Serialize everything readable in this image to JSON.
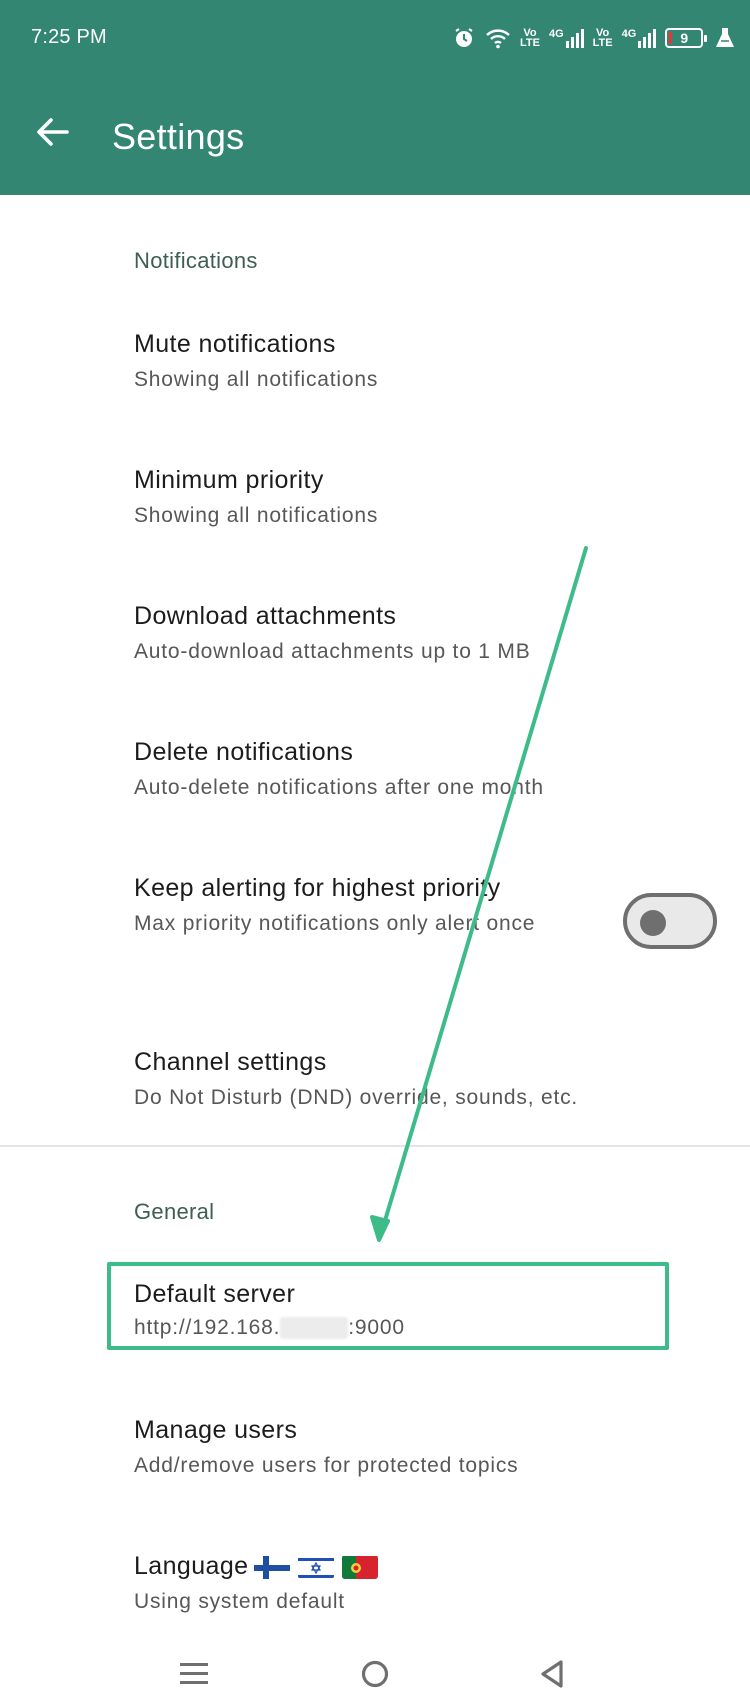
{
  "status_bar": {
    "time": "7:25 PM",
    "volte1": "Vo\nLTE",
    "net1": "4G",
    "volte2": "Vo\nLTE",
    "net2": "4G",
    "battery_level": "9",
    "icons": [
      "alarm-icon",
      "wifi-icon",
      "volte-icon",
      "signal-icon",
      "volte-icon",
      "signal-icon",
      "battery-icon",
      "flask-icon"
    ]
  },
  "app_bar": {
    "title": "Settings",
    "color": "#338772"
  },
  "sections": {
    "notifications": {
      "header": "Notifications",
      "items": [
        {
          "title": "Mute notifications",
          "summary": "Showing all notifications"
        },
        {
          "title": "Minimum priority",
          "summary": "Showing all notifications"
        },
        {
          "title": "Download attachments",
          "summary": "Auto-download attachments up to 1 MB"
        },
        {
          "title": "Delete notifications",
          "summary": "Auto-delete notifications after one month"
        },
        {
          "title": "Keep alerting for highest priority",
          "summary": "Max priority notifications only alert once",
          "toggle_on": false
        },
        {
          "title": "Channel settings",
          "summary": "Do Not Disturb (DND) override, sounds, etc."
        }
      ]
    },
    "general": {
      "header": "General",
      "items": [
        {
          "title": "Default server",
          "summary_prefix": "http://192.168.",
          "summary_suffix": ":9000"
        },
        {
          "title": "Manage users",
          "summary": "Add/remove users for protected topics"
        },
        {
          "title": "Language",
          "summary": "Using system default",
          "flags": [
            "finland-flag",
            "israel-flag",
            "portugal-flag"
          ]
        }
      ]
    }
  },
  "annotation": {
    "color": "#3dbc8a"
  },
  "nav_bar": {
    "icons": [
      "menu-icon",
      "home-icon",
      "back-triangle-icon"
    ]
  }
}
